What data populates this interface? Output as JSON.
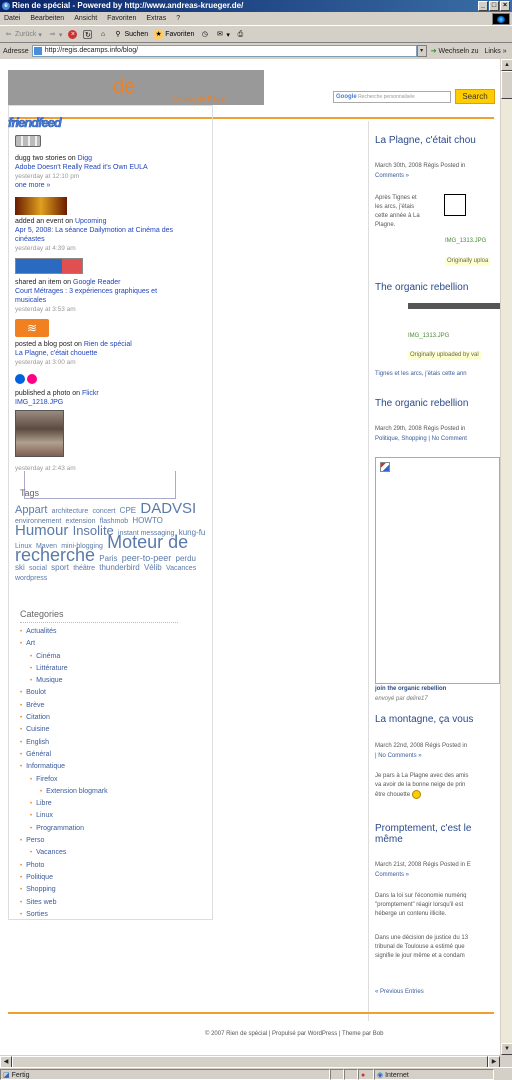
{
  "window": {
    "title": "Rien de spécial - Powered by http://www.andreas-krueger.de/",
    "buttons": [
      "_",
      "□",
      "×"
    ]
  },
  "menu": [
    "Datei",
    "Bearbeiten",
    "Ansicht",
    "Favoriten",
    "Extras",
    "?"
  ],
  "toolbar": {
    "back": "Zurück",
    "search": "Suchen",
    "favorites": "Favoriten"
  },
  "address": {
    "label": "Adresse",
    "url": "http://regis.decamps.info/blog/",
    "go": "Wechseln zu",
    "links": "Links"
  },
  "page": {
    "logo": "de",
    "tagline": "Le blog de Régis",
    "search_placeholder": "Recherche personnalisée",
    "search_brand": "Google",
    "search_button": "Search"
  },
  "friendfeed": {
    "logo": "friendfeed",
    "entries": [
      {
        "action": "dugg two stories on",
        "service": "Digg",
        "title": "Adobe Doesn't Really Read it's Own EULA",
        "time": "yesterday at 12:10 pm",
        "extra": "one more »"
      },
      {
        "action": "added an event on",
        "service": "Upcoming",
        "title": "Apr 5, 2008: La séance Dailymotion at Cinéma des cinéastes",
        "time": "yesterday at 4:39 am"
      },
      {
        "action": "shared an item on",
        "service": "Google Reader",
        "title": "Court Métrages : 3 expériences graphiques et musicales",
        "time": "yesterday at 3:53 am"
      },
      {
        "action": "posted a blog post on",
        "service": "Rien de spécial",
        "title": "La Plagne, c'était chouette",
        "time": "yesterday at 3:00 am"
      },
      {
        "action": "published a photo on",
        "service": "Flickr",
        "title": "IMG_1218.JPG",
        "time": "yesterday at 2:43 am"
      }
    ]
  },
  "tags": {
    "title": "Tags",
    "items": [
      {
        "t": "Appart",
        "s": 11
      },
      {
        "t": "architecture",
        "s": 7
      },
      {
        "t": "concert",
        "s": 7
      },
      {
        "t": "CPE",
        "s": 8
      },
      {
        "t": "DADVSI",
        "s": 15
      },
      {
        "t": "environnement",
        "s": 7
      },
      {
        "t": "extension",
        "s": 7
      },
      {
        "t": "flashmob",
        "s": 7
      },
      {
        "t": "HOWTO",
        "s": 8
      },
      {
        "t": "Humour",
        "s": 15
      },
      {
        "t": "Insolite",
        "s": 13
      },
      {
        "t": "instant messaging",
        "s": 7
      },
      {
        "t": "kung-fu",
        "s": 8
      },
      {
        "t": "Linux",
        "s": 7
      },
      {
        "t": "Maven",
        "s": 7
      },
      {
        "t": "mini-blogging",
        "s": 7
      },
      {
        "t": "Moteur de recherche",
        "s": 18
      },
      {
        "t": "Paris",
        "s": 8
      },
      {
        "t": "peer-to-peer",
        "s": 9
      },
      {
        "t": "perdu",
        "s": 8
      },
      {
        "t": "ski",
        "s": 8
      },
      {
        "t": "social",
        "s": 7
      },
      {
        "t": "sport",
        "s": 8
      },
      {
        "t": "théâtre",
        "s": 7
      },
      {
        "t": "thunderbird",
        "s": 8
      },
      {
        "t": "Vélib",
        "s": 8
      },
      {
        "t": "Vacances",
        "s": 7
      },
      {
        "t": "wordpress",
        "s": 7
      }
    ]
  },
  "categories": {
    "title": "Categories",
    "items": [
      {
        "label": "Actualités",
        "level": 0
      },
      {
        "label": "Art",
        "level": 0
      },
      {
        "label": "Cinéma",
        "level": 1
      },
      {
        "label": "Littérature",
        "level": 1
      },
      {
        "label": "Musique",
        "level": 1
      },
      {
        "label": "Boulot",
        "level": 0
      },
      {
        "label": "Brève",
        "level": 0
      },
      {
        "label": "Citation",
        "level": 0
      },
      {
        "label": "Cuisine",
        "level": 0
      },
      {
        "label": "English",
        "level": 0
      },
      {
        "label": "Général",
        "level": 0
      },
      {
        "label": "Informatique",
        "level": 0
      },
      {
        "label": "Firefox",
        "level": 1
      },
      {
        "label": "Extension blogmark",
        "level": 2
      },
      {
        "label": "Libre",
        "level": 1
      },
      {
        "label": "Linux",
        "level": 1
      },
      {
        "label": "Programmation",
        "level": 1
      },
      {
        "label": "Perso",
        "level": 0
      },
      {
        "label": "Vacances",
        "level": 1
      },
      {
        "label": "Photo",
        "level": 0
      },
      {
        "label": "Politique",
        "level": 0
      },
      {
        "label": "Shopping",
        "level": 0
      },
      {
        "label": "Sites web",
        "level": 0
      },
      {
        "label": "Sorties",
        "level": 0
      }
    ]
  },
  "posts": {
    "p1_title": "La Plagne, c'était chou",
    "p1_meta": "March 30th, 2008 Régis Posted in",
    "p1_comments": "Comments »",
    "p1_text": [
      "Après Tignes et",
      "les arcs, j'étais",
      "cette année à La",
      "Plagne."
    ],
    "p1_img": "IMG_1313.JPG",
    "p1_uploaded": "Originally uploa",
    "p2_title": "The organic rebellion",
    "p2_img": "IMG_1313.JPG",
    "p2_uploaded": "Originally uploaded by val",
    "p2_text": "Tignes et les arcs, j'étais cette ann",
    "p3_title": "The organic rebellion",
    "p3_meta": "March 29th, 2008 Régis Posted in",
    "p3_meta2": "Politique, Shopping | No Comment",
    "p3_caption": "join the organic rebellion",
    "p3_sent": "envoyé par delire17",
    "p4_title": "La montagne, ça vous",
    "p4_meta": "March 22nd, 2008 Régis Posted in",
    "p4_meta2": "| No Comments »",
    "p4_text": [
      "Je pars à La Plagne avec des amis",
      "va avoir de la bonne neige de prin",
      "être chouette"
    ],
    "p5_title": "Promptement, c'est le",
    "p5_title2": "même",
    "p5_meta": "March 21st, 2008 Régis Posted in E",
    "p5_meta2": "Comments »",
    "p5_text": [
      "Dans la loi sur l'économie numériq",
      "\"promptement\" réagir lorsqu'il est",
      "héberge un contenu illicite."
    ],
    "p5_text2": [
      "Dans une décision de justice du 13",
      "tribunal de Toulouse a estimé que",
      "signifie le jour même et a condam"
    ],
    "prev": "« Previous Entries"
  },
  "footer": "© 2007 Rien de spécial | Propulsé par WordPress | Theme par Bob",
  "status": {
    "left": "Fertig",
    "zone": "Internet"
  }
}
